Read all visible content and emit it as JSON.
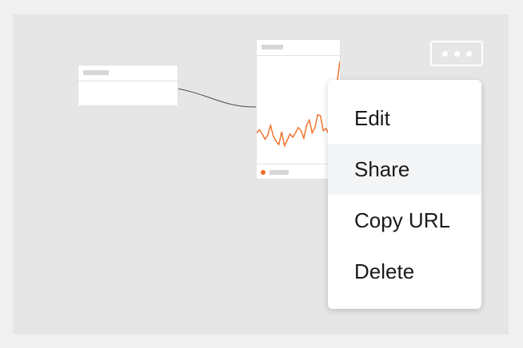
{
  "colors": {
    "canvas_bg": "#e6e6e6",
    "page_bg": "#f0f0f0",
    "series_accent": "#f26b21",
    "menu_hover": "#f4f5f7",
    "connector": "#4a4a4a"
  },
  "toolbar": {
    "more_icon": "more-horizontal-icon"
  },
  "chart_data": {
    "type": "line",
    "x": [
      0,
      1,
      2,
      3,
      4,
      5,
      6,
      7,
      8,
      9,
      10,
      11,
      12,
      13,
      14,
      15,
      16,
      17,
      18,
      19,
      20,
      21,
      22,
      23,
      24,
      25,
      26,
      27,
      28,
      29,
      30
    ],
    "series": [
      {
        "values": [
          28,
          31,
          27,
          22,
          26,
          35,
          25,
          20,
          17,
          29,
          16,
          21,
          27,
          24,
          28,
          33,
          30,
          23,
          35,
          40,
          28,
          33,
          45,
          44,
          30,
          32,
          27,
          33,
          31,
          75,
          95
        ],
        "color": "#f26b21"
      }
    ]
  },
  "menu": {
    "items": [
      {
        "label": "Edit",
        "hovered": false
      },
      {
        "label": "Share",
        "hovered": true
      },
      {
        "label": "Copy URL",
        "hovered": false
      },
      {
        "label": "Delete",
        "hovered": false
      }
    ]
  }
}
